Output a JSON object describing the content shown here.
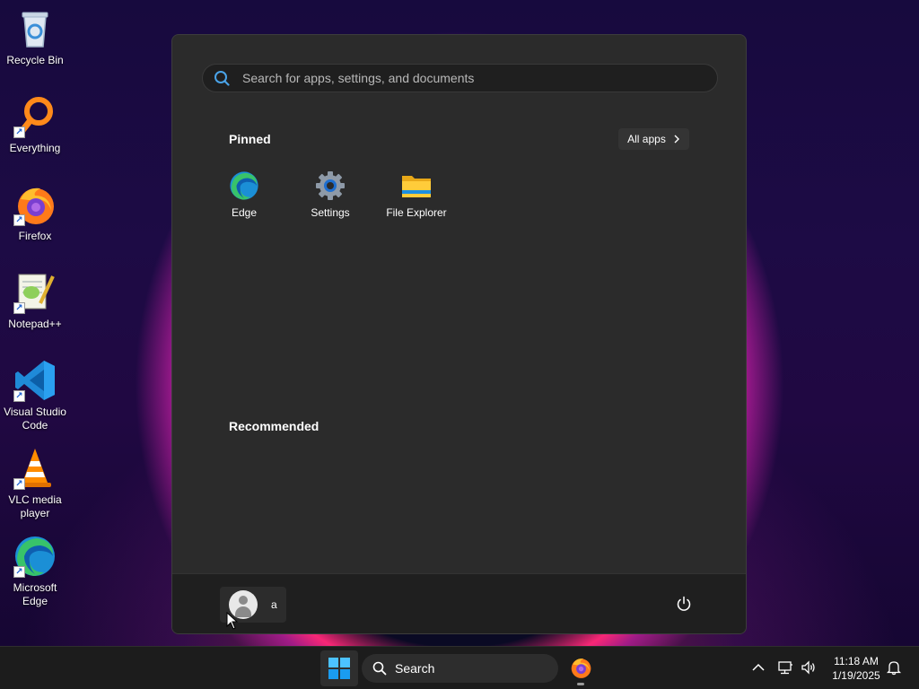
{
  "desktop": {
    "icons": [
      {
        "label": "Recycle Bin",
        "icon": "recycle-bin-icon"
      },
      {
        "label": "Everything",
        "icon": "everything-icon"
      },
      {
        "label": "Firefox",
        "icon": "firefox-icon"
      },
      {
        "label": "Notepad++",
        "icon": "notepadpp-icon"
      },
      {
        "label": "Visual Studio Code",
        "icon": "vscode-icon"
      },
      {
        "label": "VLC media player",
        "icon": "vlc-icon"
      },
      {
        "label": "Microsoft Edge",
        "icon": "edge-icon"
      }
    ]
  },
  "start_menu": {
    "search_placeholder": "Search for apps, settings, and documents",
    "pinned_title": "Pinned",
    "all_apps_label": "All apps",
    "pinned_apps": [
      {
        "label": "Edge",
        "icon": "edge-icon"
      },
      {
        "label": "Settings",
        "icon": "settings-gear-icon"
      },
      {
        "label": "File Explorer",
        "icon": "folder-icon"
      }
    ],
    "recommended_title": "Recommended",
    "user_name": "a"
  },
  "taskbar": {
    "search_label": "Search",
    "time": "11:18 AM",
    "date": "1/19/2025"
  },
  "colors": {
    "menu_bg": "#2b2b2b",
    "taskbar_bg": "#1c1c1c",
    "accent": "#0078d4"
  }
}
